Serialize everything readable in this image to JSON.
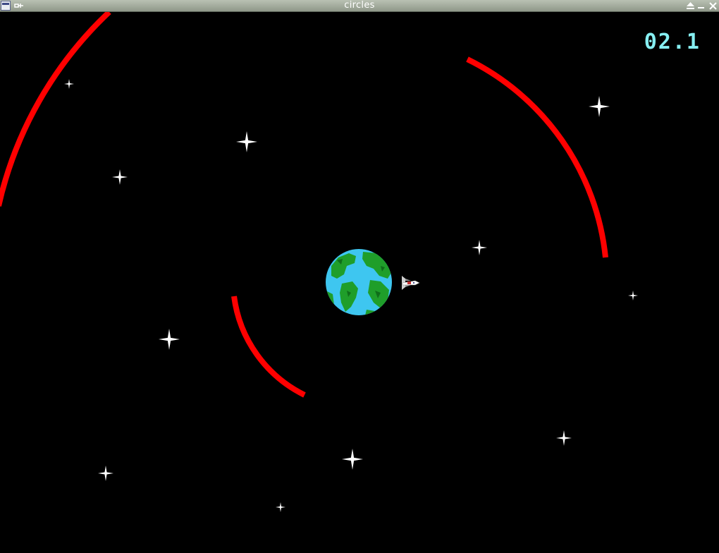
{
  "window": {
    "title": "circles",
    "buttons": {
      "menu": "window-menu-icon",
      "pin": "pin-icon",
      "shade": "shade-icon",
      "minimize": "minimize-icon",
      "close": "close-icon"
    }
  },
  "game": {
    "timer": "02.1",
    "colors": {
      "background": "#000000",
      "ring": "#ff0000",
      "star": "#ffffff",
      "timer": "#86eff2",
      "ocean": "#3ec6f0",
      "land": "#1f9e2a"
    },
    "sprites": {
      "planet": "earth-icon",
      "ship": "space-shuttle-icon",
      "stars": "star-icon"
    }
  }
}
